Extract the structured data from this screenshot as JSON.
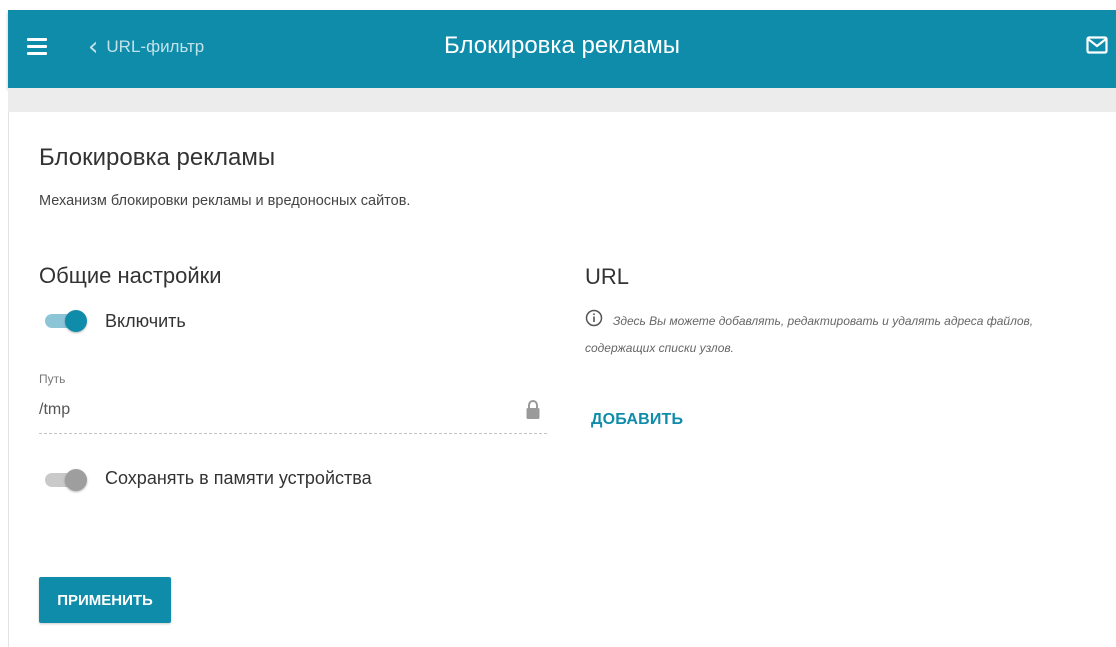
{
  "header": {
    "back_label": "URL-фильтр",
    "title": "Блокировка рекламы",
    "menu_icon": "hamburger-menu-icon",
    "back_icon": "chevron-left-icon",
    "mail_icon": "mail-icon",
    "bar_color": "#0f8caa"
  },
  "main": {
    "title": "Блокировка рекламы",
    "description": "Механизм блокировки рекламы и вредоносных сайтов."
  },
  "general": {
    "title": "Общие настройки",
    "enable_label": "Включить",
    "enable_state": true,
    "path_label": "Путь",
    "path_value": "/tmp",
    "path_locked": true,
    "save_label": "Сохранять в памяти устройства",
    "save_state": false
  },
  "url": {
    "title": "URL",
    "info_text": "Здесь Вы можете добавлять, редактировать и удалять адреса файлов, содержащих списки узлов.",
    "add_label": "ДОБАВИТЬ"
  },
  "footer": {
    "apply_label": "ПРИМЕНИТЬ"
  },
  "colors": {
    "accent": "#0f8caa",
    "toggle_off": "#9e9e9e"
  }
}
